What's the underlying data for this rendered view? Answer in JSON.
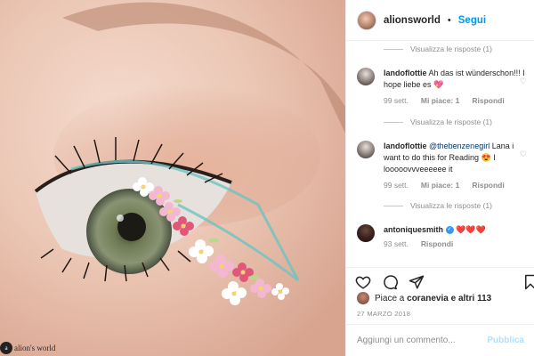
{
  "post": {
    "watermark": "alion's world",
    "watermark_logo": "a"
  },
  "header": {
    "username": "alionsworld",
    "separator": "•",
    "follow_label": "Segui"
  },
  "comments": [
    {
      "view_replies": "Visualizza le risposte (1)"
    },
    {
      "user": "landoflottie",
      "text": "Ah das ist wünderschon!!! I hope liebe es 💖",
      "time": "99 sett.",
      "likes": "Mi piace: 1",
      "reply": "Rispondi",
      "view_replies": "Visualizza le risposte (1)"
    },
    {
      "user": "landoflottie",
      "mention": "@thebenzenegirl",
      "text": " Lana i want to do this for Reading 😍 I looooovvveeeeee it",
      "time": "99 sett.",
      "likes": "Mi piace: 1",
      "reply": "Rispondi",
      "view_replies": "Visualizza le risposte (1)"
    },
    {
      "user": "antoniquesmith",
      "verified": "✓",
      "text": "❤️❤️❤️",
      "time": "93 sett.",
      "reply": "Rispondi"
    }
  ],
  "likes": {
    "prefix": "Piace a ",
    "user": "coranevia",
    "middle": " e ",
    "others": "altri 113"
  },
  "date": "27 MARZO 2018",
  "add_comment": {
    "placeholder": "Aggiungi un commento...",
    "publish_label": "Pubblica"
  },
  "icons": [
    "heart-icon",
    "comment-icon",
    "share-icon",
    "bookmark-icon",
    "small-heart-icon"
  ],
  "colors": {
    "link": "#0095f6",
    "mention": "#00376b",
    "secondary_text": "#8e8e8e",
    "publish_disabled": "#b2dffc"
  }
}
